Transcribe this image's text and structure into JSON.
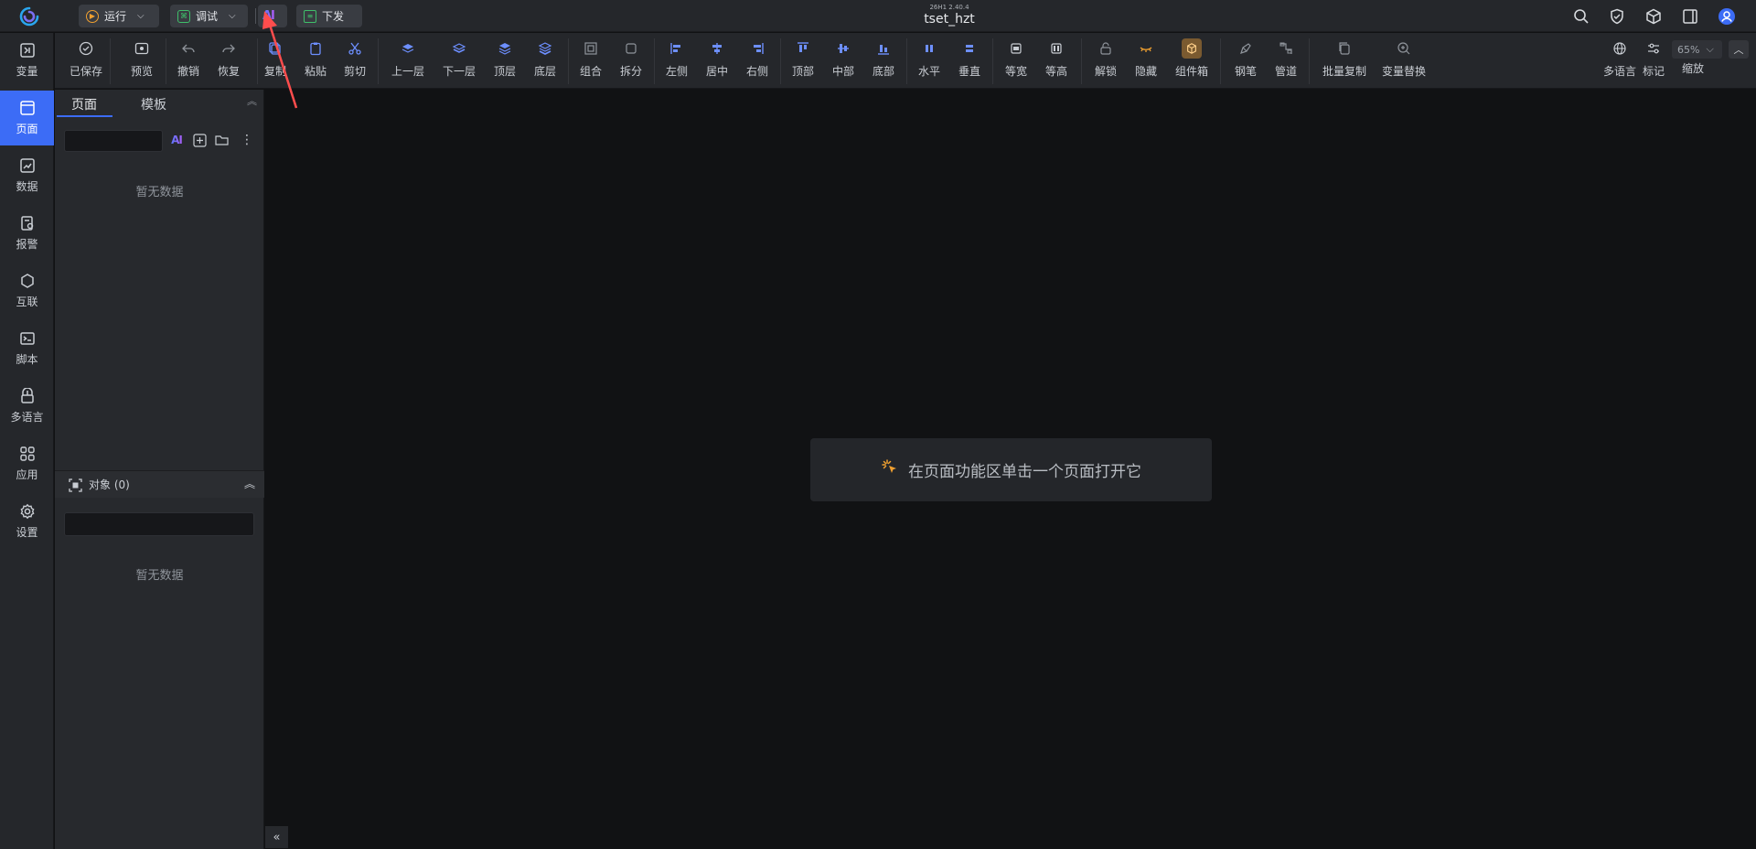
{
  "titlebar": {
    "version": "26H1 2.40.4",
    "project_name": "tset_hzt",
    "run_label": "运行",
    "debug_label": "调试",
    "ai_label": "AI",
    "deploy_label": "下发"
  },
  "rail": {
    "items": [
      {
        "label": "变量",
        "icon": "variable-icon",
        "active": false
      },
      {
        "label": "页面",
        "icon": "page-icon",
        "active": true
      },
      {
        "label": "数据",
        "icon": "data-icon",
        "active": false
      },
      {
        "label": "报警",
        "icon": "alarm-icon",
        "active": false
      },
      {
        "label": "互联",
        "icon": "interconnect-icon",
        "active": false
      },
      {
        "label": "脚本",
        "icon": "script-icon",
        "active": false
      },
      {
        "label": "多语言",
        "icon": "language-icon",
        "active": false
      },
      {
        "label": "应用",
        "icon": "apps-icon",
        "active": false
      },
      {
        "label": "设置",
        "icon": "gear-icon",
        "active": false
      }
    ]
  },
  "toolbar": {
    "saved": "已保存",
    "preview": "预览",
    "undo": "撤销",
    "redo": "恢复",
    "copy": "复制",
    "paste": "粘贴",
    "cut": "剪切",
    "layer_up": "上一层",
    "layer_down": "下一层",
    "top_layer": "顶层",
    "bottom_layer": "底层",
    "group": "组合",
    "ungroup": "拆分",
    "align_left": "左侧",
    "align_center": "居中",
    "align_right": "右侧",
    "align_top": "顶部",
    "align_middle": "中部",
    "align_bottom": "底部",
    "distribute_h": "水平",
    "distribute_v": "垂直",
    "equal_width": "等宽",
    "equal_height": "等高",
    "unlock": "解锁",
    "hide": "隐藏",
    "component_box": "组件箱",
    "pen": "钢笔",
    "pipe": "管道",
    "batch_copy": "批量复制",
    "variable_replace": "变量替换",
    "multilang": "多语言",
    "mark": "标记",
    "zoom_label": "缩放",
    "zoom_value": "65%"
  },
  "panel": {
    "tab_pages": "页面",
    "tab_templates": "模板",
    "pages_empty": "暂无数据",
    "objects_title": "对象 (0)",
    "objects_empty": "暂无数据",
    "search_value": "",
    "objects_search_value": ""
  },
  "canvas": {
    "hint": "在页面功能区单击一个页面打开它"
  },
  "colors": {
    "accent": "#3c6cf6",
    "annotation_arrow": "#ff4d4d"
  }
}
